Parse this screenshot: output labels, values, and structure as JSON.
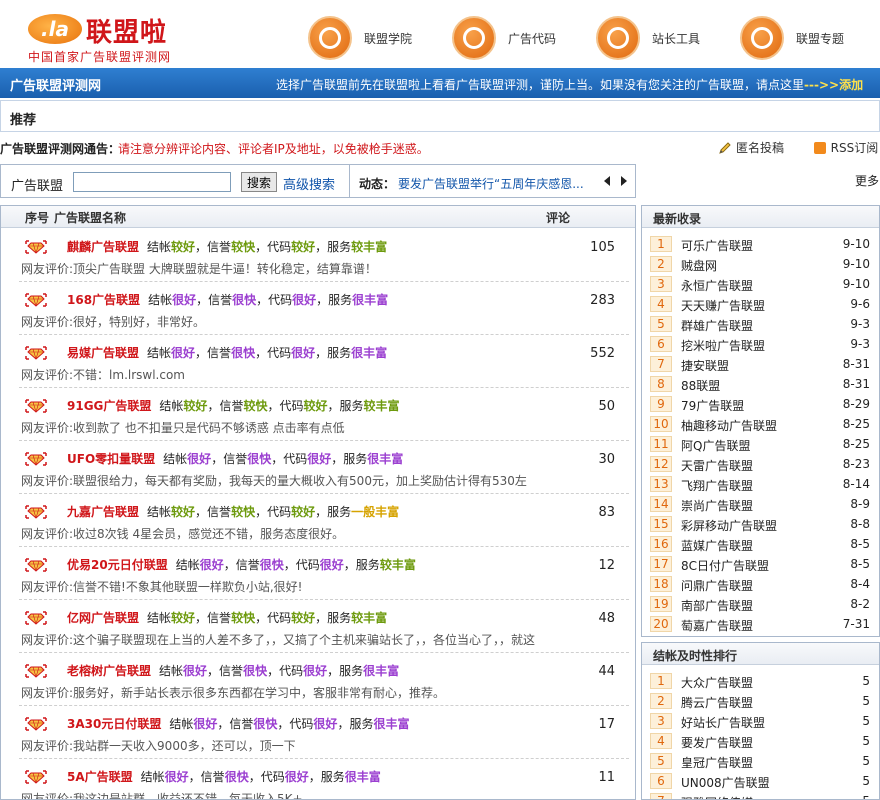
{
  "header": {
    "logo_badge": ".la",
    "logo_title": "联盟啦",
    "logo_sub": "中国首家广告联盟评测网",
    "nav": [
      {
        "label": "联盟学院",
        "icon": "person-icon"
      },
      {
        "label": "广告代码",
        "icon": "code-arrow-icon"
      },
      {
        "label": "站长工具",
        "icon": "wrench-icon"
      },
      {
        "label": "联盟专题",
        "icon": "network-icon"
      }
    ]
  },
  "bluebar": {
    "title": "广告联盟评测网",
    "note": "选择广告联盟前先在联盟啦上看看广告联盟评测，谨防上当。如果没有您关注的广告联盟，请点这里",
    "link": "--->>添加"
  },
  "recommend": {
    "label": "推荐"
  },
  "notice": {
    "label": "广告联盟评测网通告：",
    "text": "请注意分辨评论内容、评论者IP及地址，以免被枪手迷惑。",
    "submit": "匿名投稿",
    "rss": "RSS订阅"
  },
  "search": {
    "label": "广告联盟",
    "value": "",
    "button": "搜索",
    "advanced": "高级搜索",
    "dynamic_label": "动态：",
    "dynamic_text": "要发广告联盟举行“五周年庆感恩...",
    "more": "更多"
  },
  "list": {
    "headers": {
      "index": "序号",
      "name": "广告联盟名称",
      "comments": "评论"
    },
    "rows": [
      {
        "name": "麒麟广告联盟",
        "settle": "较好",
        "settle_c": "green",
        "credit": "较快",
        "credit_c": "green",
        "code": "较好",
        "code_c": "green",
        "service": "较丰富",
        "service_c": "green",
        "count": "105",
        "review": "网友评价:顶尖广告联盟 大牌联盟就是牛逼！转化稳定，结算靠谱！"
      },
      {
        "name": "168广告联盟",
        "settle": "很好",
        "settle_c": "purple",
        "credit": "很快",
        "credit_c": "purple",
        "code": "很好",
        "code_c": "purple",
        "service": "很丰富",
        "service_c": "purple",
        "count": "283",
        "review": "网友评价:很好，特别好，非常好。"
      },
      {
        "name": "易媒广告联盟",
        "settle": "很好",
        "settle_c": "purple",
        "credit": "很快",
        "credit_c": "purple",
        "code": "很好",
        "code_c": "purple",
        "service": "很丰富",
        "service_c": "purple",
        "count": "552",
        "review": "网友评价:不错：lm.lrswl.com"
      },
      {
        "name": "91GG广告联盟",
        "settle": "较好",
        "settle_c": "green",
        "credit": "较快",
        "credit_c": "green",
        "code": "较好",
        "code_c": "green",
        "service": "较丰富",
        "service_c": "green",
        "count": "50",
        "review": "网友评价:收到款了 也不扣量只是代码不够诱惑 点击率有点低"
      },
      {
        "name": "UFO零扣量联盟",
        "settle": "很好",
        "settle_c": "purple",
        "credit": "很快",
        "credit_c": "purple",
        "code": "很好",
        "code_c": "purple",
        "service": "很丰富",
        "service_c": "purple",
        "count": "30",
        "review": "网友评价:联盟很给力，每天都有奖励，我每天的量大概收入有500元，加上奖励估计得有530左"
      },
      {
        "name": "九嘉广告联盟",
        "settle": "较好",
        "settle_c": "green",
        "credit": "较快",
        "credit_c": "green",
        "code": "较好",
        "code_c": "green",
        "service": "一般丰富",
        "service_c": "orange",
        "count": "83",
        "review": "网友评价:收过8次钱 4星会员，感觉还不错，服务态度很好。"
      },
      {
        "name": "优易20元日付联盟",
        "settle": "很好",
        "settle_c": "purple",
        "credit": "很快",
        "credit_c": "purple",
        "code": "很好",
        "code_c": "purple",
        "service": "较丰富",
        "service_c": "green",
        "count": "12",
        "review": "网友评价:信誉不错!不象其他联盟一样欺负小站,很好!"
      },
      {
        "name": "亿网广告联盟",
        "settle": "较好",
        "settle_c": "green",
        "credit": "较快",
        "credit_c": "green",
        "code": "较好",
        "code_c": "green",
        "service": "较丰富",
        "service_c": "green",
        "count": "48",
        "review": "网友评价:这个骗子联盟现在上当的人差不多了，，又搞了个主机来骗站长了，，各位当心了，，就这"
      },
      {
        "name": "老榕树广告联盟",
        "settle": "很好",
        "settle_c": "purple",
        "credit": "很快",
        "credit_c": "purple",
        "code": "很好",
        "code_c": "purple",
        "service": "很丰富",
        "service_c": "purple",
        "count": "44",
        "review": "网友评价:服务好，新手站长表示很多东西都在学习中，客服非常有耐心，推荐。"
      },
      {
        "name": "3A30元日付联盟",
        "settle": "很好",
        "settle_c": "purple",
        "credit": "很快",
        "credit_c": "purple",
        "code": "很好",
        "code_c": "purple",
        "service": "很丰富",
        "service_c": "purple",
        "count": "17",
        "review": "网友评价:我站群一天收入9000多，还可以，顶一下"
      },
      {
        "name": "5A广告联盟",
        "settle": "很好",
        "settle_c": "purple",
        "credit": "很快",
        "credit_c": "purple",
        "code": "很好",
        "code_c": "purple",
        "service": "很丰富",
        "service_c": "purple",
        "count": "11",
        "review": "网友评价:我这边是站群，收益还不错，每天收入5K+"
      }
    ]
  },
  "latest": {
    "title": "最新收录",
    "items": [
      {
        "n": "1",
        "name": "可乐广告联盟",
        "date": "9-10"
      },
      {
        "n": "2",
        "name": "贼盘网",
        "date": "9-10"
      },
      {
        "n": "3",
        "name": "永恒广告联盟",
        "date": "9-10"
      },
      {
        "n": "4",
        "name": "天天赚广告联盟",
        "date": "9-6"
      },
      {
        "n": "5",
        "name": "群雄广告联盟",
        "date": "9-3"
      },
      {
        "n": "6",
        "name": "挖米啦广告联盟",
        "date": "9-3"
      },
      {
        "n": "7",
        "name": "捷安联盟",
        "date": "8-31"
      },
      {
        "n": "8",
        "name": "88联盟",
        "date": "8-31"
      },
      {
        "n": "9",
        "name": "79广告联盟",
        "date": "8-29"
      },
      {
        "n": "10",
        "name": "柚趣移动广告联盟",
        "date": "8-25"
      },
      {
        "n": "11",
        "name": "阿Q广告联盟",
        "date": "8-25"
      },
      {
        "n": "12",
        "name": "天雷广告联盟",
        "date": "8-23"
      },
      {
        "n": "13",
        "name": "飞翔广告联盟",
        "date": "8-14"
      },
      {
        "n": "14",
        "name": "崇尚广告联盟",
        "date": "8-9"
      },
      {
        "n": "15",
        "name": "彩屏移动广告联盟",
        "date": "8-8"
      },
      {
        "n": "16",
        "name": "蓝媒广告联盟",
        "date": "8-5"
      },
      {
        "n": "17",
        "name": "8C日付广告联盟",
        "date": "8-5"
      },
      {
        "n": "18",
        "name": "问鼎广告联盟",
        "date": "8-4"
      },
      {
        "n": "19",
        "name": "南部广告联盟",
        "date": "8-2"
      },
      {
        "n": "20",
        "name": "萄嘉广告联盟",
        "date": "7-31"
      }
    ]
  },
  "ranking": {
    "title": "结帐及时性排行",
    "items": [
      {
        "n": "1",
        "name": "大众广告联盟",
        "score": "5"
      },
      {
        "n": "2",
        "name": "腾云广告联盟",
        "score": "5"
      },
      {
        "n": "3",
        "name": "好站长广告联盟",
        "score": "5"
      },
      {
        "n": "4",
        "name": "要发广告联盟",
        "score": "5"
      },
      {
        "n": "5",
        "name": "皇冠广告联盟",
        "score": "5"
      },
      {
        "n": "6",
        "name": "UN008广告联盟",
        "score": "5"
      },
      {
        "n": "7",
        "name": "强雅网络传媒",
        "score": "5"
      }
    ]
  },
  "colors": {
    "brand_red": "#d0161a",
    "bar_blue": "#1a5fae",
    "green": "#6d9a0d",
    "purple": "#9b3fd0",
    "orange": "#d6a300"
  }
}
